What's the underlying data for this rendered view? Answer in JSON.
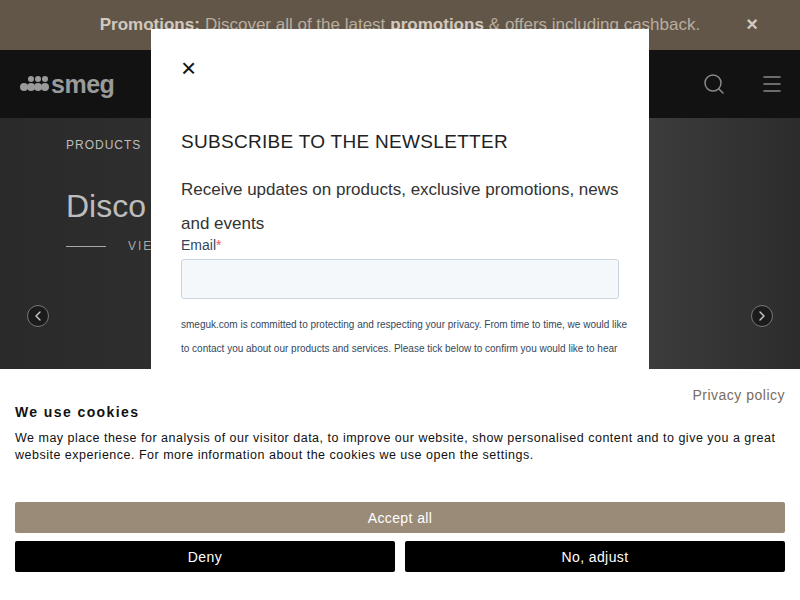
{
  "promo_bar": {
    "segments": [
      {
        "text": "Promotions:",
        "bold": true
      },
      {
        "text": "Discover all of the latest",
        "bold": false
      },
      {
        "text": "promotions",
        "bold": true
      },
      {
        "text": "& offers including cashback.",
        "bold": false
      }
    ],
    "close": "×"
  },
  "header": {
    "logo": "smeg"
  },
  "hero": {
    "eyebrow": "PRODUCTS",
    "title": "Disco",
    "link": "VIE"
  },
  "modal": {
    "close": "×",
    "title": "SUBSCRIBE TO THE NEWSLETTER",
    "text": "Receive updates on products, exclusive promotions, news and events",
    "email": {
      "label": "Email",
      "required_mark": "*",
      "value": ""
    },
    "privacy_lines": [
      "smeguk.com is committed to protecting and respecting your privacy. From time to time, we would like",
      "to contact you about our products and services. Please tick below to confirm you would like to hear"
    ]
  },
  "cookie_banner": {
    "privacy_link": "Privacy policy",
    "title": "We use cookies",
    "text": "We may place these for analysis of our visitor data, to improve our website, show personalised content and to give you a great website experience. For more information about the cookies we use open the settings.",
    "buttons": [
      {
        "label": "Accept all",
        "kind": "primary"
      },
      {
        "label": "Deny",
        "kind": "secondary"
      },
      {
        "label": "No, adjust",
        "kind": "secondary"
      }
    ]
  }
}
